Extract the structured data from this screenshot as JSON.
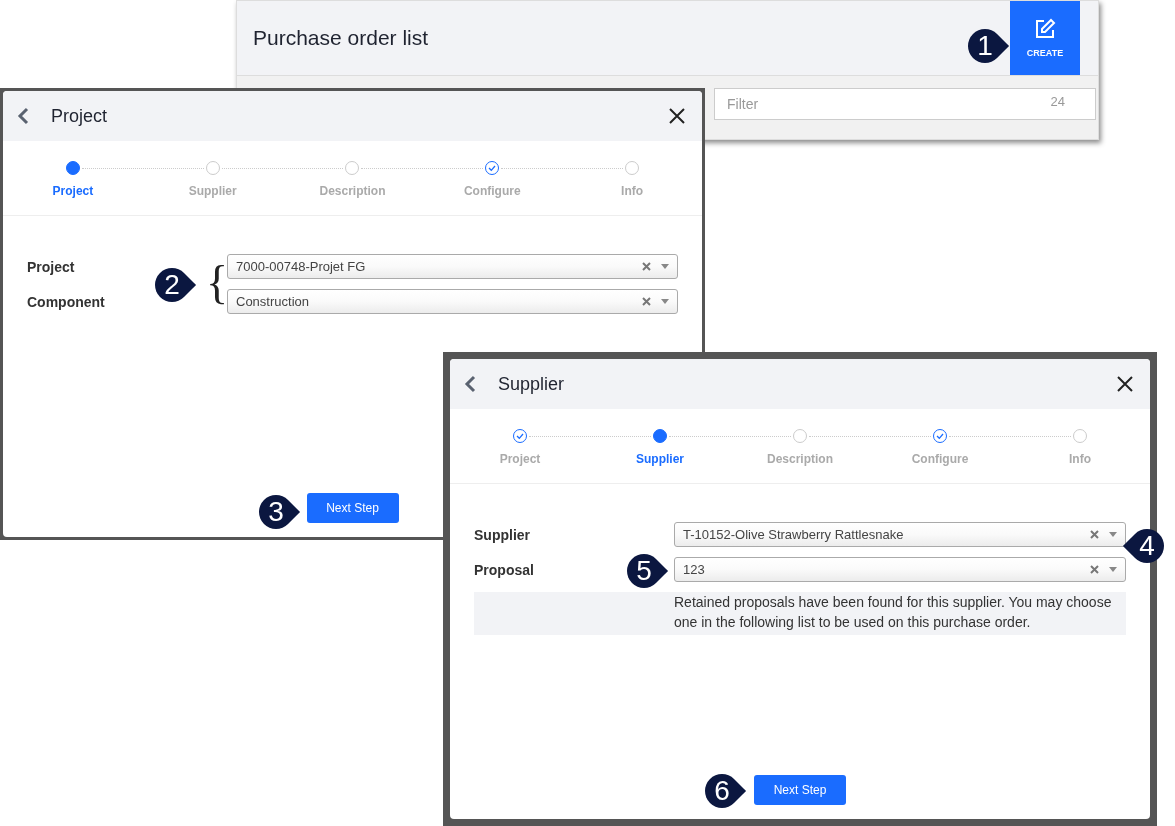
{
  "list_window": {
    "title": "Purchase order list",
    "create_button": "CREATE",
    "filter": {
      "placeholder": "Filter",
      "count": "24"
    }
  },
  "project_dialog": {
    "title": "Project",
    "steps": [
      {
        "label": "Project",
        "selected": true,
        "done": false
      },
      {
        "label": "Supplier",
        "selected": false,
        "done": false
      },
      {
        "label": "Description",
        "selected": false,
        "done": false
      },
      {
        "label": "Configure",
        "selected": false,
        "done": true
      },
      {
        "label": "Info",
        "selected": false,
        "done": false
      }
    ],
    "fields": [
      {
        "label": "Project",
        "value": "7000-00748-Projet FG"
      },
      {
        "label": "Component",
        "value": "Construction"
      }
    ],
    "brace": "{",
    "button": "Next Step"
  },
  "supplier_dialog": {
    "title": "Supplier",
    "steps": [
      {
        "label": "Project",
        "selected": false,
        "done": true
      },
      {
        "label": "Supplier",
        "selected": true,
        "done": false
      },
      {
        "label": "Description",
        "selected": false,
        "done": false
      },
      {
        "label": "Configure",
        "selected": false,
        "done": true
      },
      {
        "label": "Info",
        "selected": false,
        "done": false
      }
    ],
    "fields": [
      {
        "label": "Supplier",
        "value": "T-10152-Olive Strawberry Rattlesnake"
      },
      {
        "label": "Proposal",
        "value": "123"
      }
    ],
    "note": "Retained proposals have been found for this supplier. You may choose one in the following list to be used on this purchase order.",
    "button": "Next Step"
  },
  "callouts": [
    "1",
    "2",
    "3",
    "4",
    "5",
    "6"
  ]
}
